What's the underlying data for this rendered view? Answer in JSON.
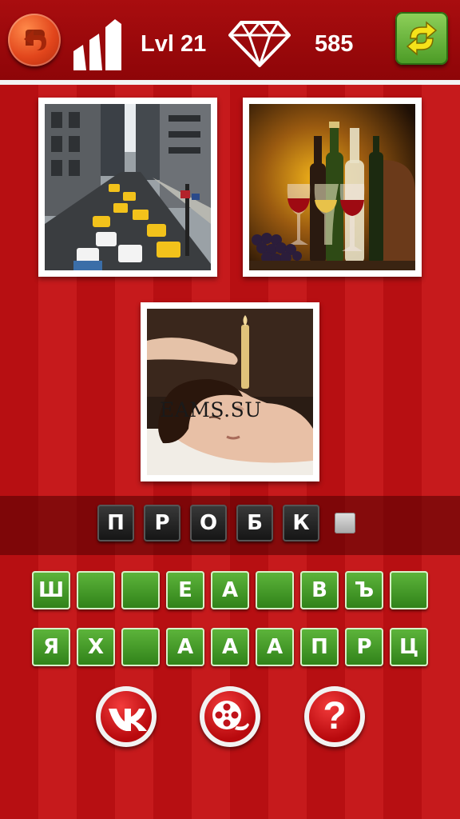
{
  "header": {
    "level_label": "Lvl 21",
    "coins": "585",
    "icons": {
      "back": "back-arrow-icon",
      "level": "level-bars-icon",
      "coins": "diamond-icon",
      "refresh": "refresh-icon"
    }
  },
  "pictures": [
    {
      "name": "city-street-taxis"
    },
    {
      "name": "wine-bottles-glasses"
    },
    {
      "name": "ear-candle-spa"
    }
  ],
  "watermark": "EAMS.SU",
  "answer": {
    "letters": [
      "П",
      "Р",
      "О",
      "Б",
      "К"
    ],
    "empty_slots": 1
  },
  "keyboard": {
    "rows": [
      [
        "Ш",
        "",
        "",
        "Е",
        "А",
        "",
        "В",
        "Ъ",
        ""
      ],
      [
        "Я",
        "Х",
        "",
        "А",
        "А",
        "А",
        "П",
        "Р",
        "Ц"
      ]
    ]
  },
  "bottom_buttons": {
    "vk": "vk-logo-icon",
    "video": "film-reel-icon",
    "help_label": "?"
  },
  "colors": {
    "background": "#b70f12",
    "key_green": "#4a9a25",
    "answer_tile": "#1c1c1c",
    "accent_red": "#d21e22"
  }
}
